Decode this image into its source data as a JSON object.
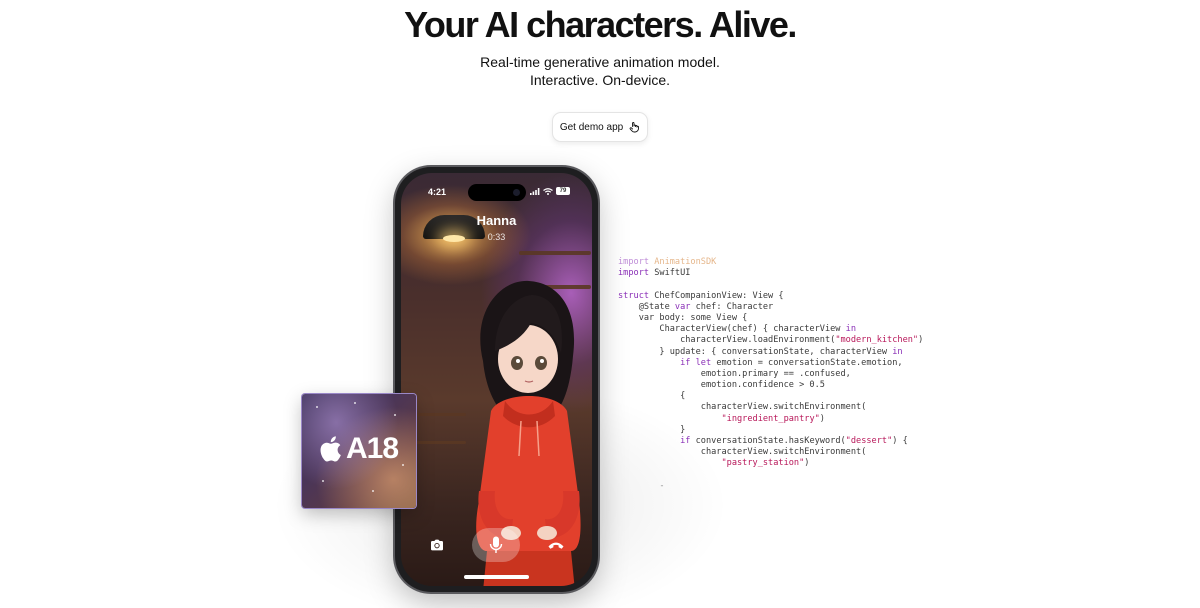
{
  "hero": {
    "title": "Your AI characters. Alive.",
    "subtitle_line1": "Real-time generative animation model.",
    "subtitle_line2": "Interactive. On-device.",
    "cta_label": "Get demo app"
  },
  "phone": {
    "status_time": "4:21",
    "battery": "79",
    "caller_name": "Hanna",
    "call_duration": "0:33",
    "icons": [
      "signal-icon",
      "wifi-icon",
      "battery-icon",
      "camera-icon",
      "microphone-icon",
      "end-call-icon"
    ]
  },
  "chip": {
    "label": "A18",
    "brand_icon": "apple-logo-icon"
  },
  "code": {
    "lines": [
      [
        {
          "t": "import ",
          "c": "kw fade"
        },
        {
          "t": "AnimationSDK",
          "c": "kw2"
        }
      ],
      [
        {
          "t": "import ",
          "c": "kw"
        },
        {
          "t": "SwiftUI",
          "c": ""
        }
      ],
      [],
      [
        {
          "t": "struct ",
          "c": "kw"
        },
        {
          "t": "ChefCompanionView: View {",
          "c": ""
        }
      ],
      [
        {
          "t": "    @State ",
          "c": ""
        },
        {
          "t": "var ",
          "c": "kw"
        },
        {
          "t": "chef: Character",
          "c": ""
        }
      ],
      [
        {
          "t": "    var body: some View {",
          "c": ""
        }
      ],
      [
        {
          "t": "        CharacterView(chef) { characterView ",
          "c": ""
        },
        {
          "t": "in",
          "c": "kw"
        }
      ],
      [
        {
          "t": "            characterView.loadEnvironment(",
          "c": ""
        },
        {
          "t": "\"modern_kitchen\"",
          "c": "str"
        },
        {
          "t": ")",
          "c": ""
        }
      ],
      [
        {
          "t": "        } update: { conversationState, characterView ",
          "c": ""
        },
        {
          "t": "in",
          "c": "kw"
        }
      ],
      [
        {
          "t": "            ",
          "c": ""
        },
        {
          "t": "if let ",
          "c": "kw"
        },
        {
          "t": "emotion = conversationState.emotion,",
          "c": ""
        }
      ],
      [
        {
          "t": "                emotion.primary == .confused,",
          "c": ""
        }
      ],
      [
        {
          "t": "                emotion.confidence > 0.5",
          "c": ""
        }
      ],
      [
        {
          "t": "            {",
          "c": ""
        }
      ],
      [
        {
          "t": "                characterView.switchEnvironment(",
          "c": ""
        }
      ],
      [
        {
          "t": "                    ",
          "c": ""
        },
        {
          "t": "\"ingredient_pantry\"",
          "c": "str"
        },
        {
          "t": ")",
          "c": ""
        }
      ],
      [
        {
          "t": "            }",
          "c": ""
        }
      ],
      [
        {
          "t": "            ",
          "c": ""
        },
        {
          "t": "if ",
          "c": "kw"
        },
        {
          "t": "conversationState.hasKeyword(",
          "c": ""
        },
        {
          "t": "\"dessert\"",
          "c": "str"
        },
        {
          "t": ") {",
          "c": ""
        }
      ],
      [
        {
          "t": "                characterView.switchEnvironment(",
          "c": ""
        }
      ],
      [
        {
          "t": "                    ",
          "c": ""
        },
        {
          "t": "\"pastry_station\"",
          "c": "str"
        },
        {
          "t": ")",
          "c": ""
        }
      ],
      [],
      [
        {
          "t": "        -",
          "c": "fade"
        }
      ]
    ]
  }
}
